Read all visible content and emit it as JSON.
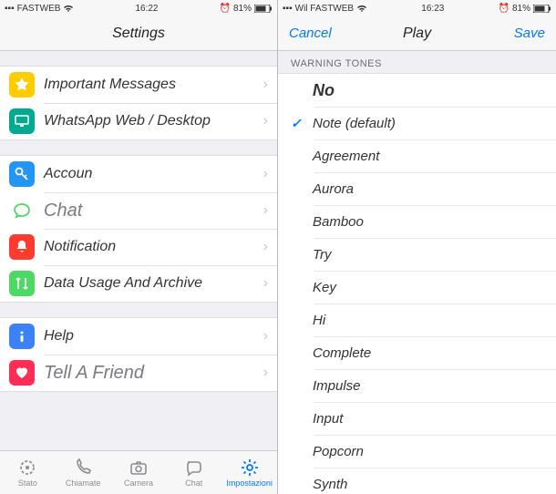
{
  "left": {
    "status": {
      "carrier": "FASTWEB",
      "time": "16:22",
      "battery": "81%"
    },
    "nav": {
      "title": "Settings"
    },
    "groups": [
      {
        "rows": [
          {
            "icon_bg": "#ffcc00",
            "icon": "star",
            "label": "Important Messages"
          },
          {
            "icon_bg": "#00a98f",
            "icon": "desktop",
            "label": "WhatsApp Web / Desktop"
          }
        ]
      },
      {
        "rows": [
          {
            "icon_bg": "#2196f3",
            "icon": "key",
            "label": "Accoun"
          },
          {
            "icon_bg": "#ffffff",
            "icon": "chat-outline",
            "label": "Chat"
          },
          {
            "icon_bg": "#ff3b30",
            "icon": "bell",
            "label": "Notification"
          },
          {
            "icon_bg": "#4cd964",
            "icon": "data",
            "label": "Data Usage And Archive"
          }
        ]
      },
      {
        "rows": [
          {
            "icon_bg": "#3b82f6",
            "icon": "info",
            "label": "Help"
          },
          {
            "icon_bg": "#ff2d55",
            "icon": "heart",
            "label": "Tell A Friend"
          }
        ]
      }
    ],
    "tabs": [
      {
        "icon": "status",
        "label": "Stato"
      },
      {
        "icon": "calls",
        "label": "Chiamate"
      },
      {
        "icon": "camera",
        "label": "Camera"
      },
      {
        "icon": "chats",
        "label": "Chat"
      },
      {
        "icon": "settings",
        "label": "Impostazioni",
        "active": true
      }
    ]
  },
  "right": {
    "status": {
      "carrier": "Wil FASTWEB",
      "time": "16:23",
      "battery": "81%"
    },
    "nav": {
      "cancel": "Cancel",
      "title": "Play",
      "save": "Save"
    },
    "section": "WARNING TONES",
    "tones": [
      {
        "label": "No",
        "big": true
      },
      {
        "label": "Note (default)",
        "checked": true
      },
      {
        "label": "Agreement"
      },
      {
        "label": "Aurora"
      },
      {
        "label": "Bamboo"
      },
      {
        "label": "Try"
      },
      {
        "label": "Key"
      },
      {
        "label": "Hi"
      },
      {
        "label": "Complete"
      },
      {
        "label": "Impulse"
      },
      {
        "label": "Input"
      },
      {
        "label": "Popcorn"
      },
      {
        "label": "Synth"
      }
    ]
  }
}
